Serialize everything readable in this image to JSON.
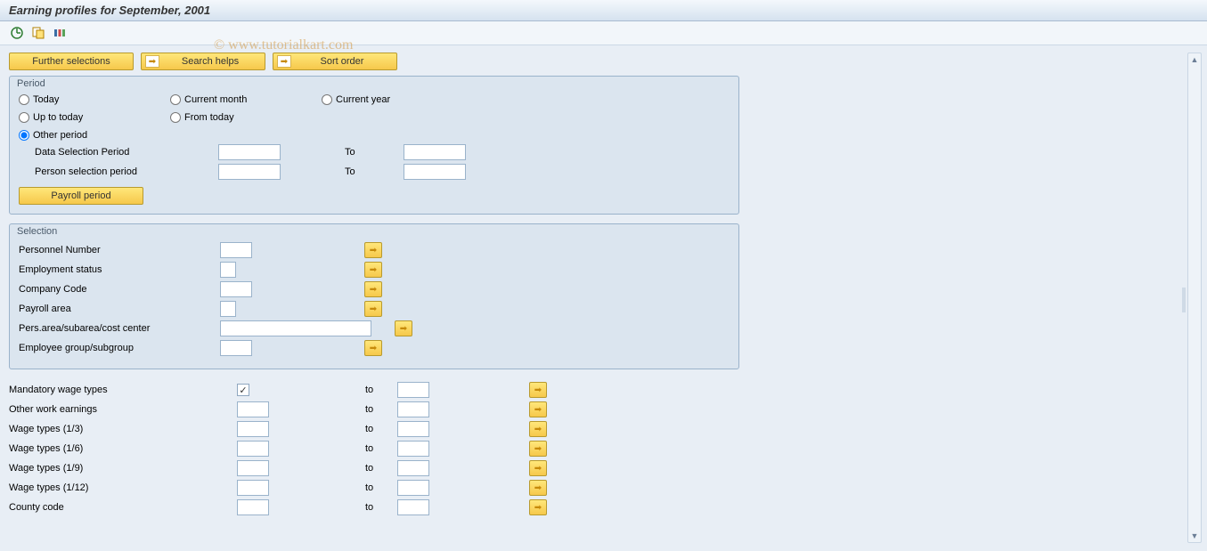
{
  "title": "Earning profiles for September, 2001",
  "watermark": "© www.tutorialkart.com",
  "toolbar_icons": {
    "execute": "execute-icon",
    "variant": "variant-icon",
    "table": "table-icon"
  },
  "top_buttons": {
    "further_selections": "Further selections",
    "search_helps": "Search helps",
    "sort_order": "Sort order"
  },
  "group_period": {
    "title": "Period",
    "radios": {
      "today": "Today",
      "current_month": "Current month",
      "current_year": "Current year",
      "up_to_today": "Up to today",
      "from_today": "From today",
      "other_period": "Other period"
    },
    "selected": "other_period",
    "data_sel_label": "Data Selection Period",
    "person_sel_label": "Person selection period",
    "to_label": "To",
    "payroll_btn": "Payroll period"
  },
  "group_selection": {
    "title": "Selection",
    "rows": [
      {
        "label": "Personnel Number",
        "w": "w36"
      },
      {
        "label": "Employment status",
        "w": "w18"
      },
      {
        "label": "Company Code",
        "w": "w36"
      },
      {
        "label": "Payroll area",
        "w": "w18"
      },
      {
        "label": "Pers.area/subarea/cost center",
        "w": "w170"
      },
      {
        "label": "Employee group/subgroup",
        "w": "w36"
      }
    ]
  },
  "wage_types": {
    "to_label": "to",
    "rows": [
      {
        "label": "Mandatory wage types",
        "checkbox": true,
        "checked": true
      },
      {
        "label": "Other work earnings",
        "checkbox": false
      },
      {
        "label": "Wage types (1/3)",
        "checkbox": false
      },
      {
        "label": "Wage types (1/6)",
        "checkbox": false
      },
      {
        "label": "Wage types (1/9)",
        "checkbox": false
      },
      {
        "label": "Wage types (1/12)",
        "checkbox": false
      },
      {
        "label": "County code",
        "checkbox": false
      }
    ]
  }
}
